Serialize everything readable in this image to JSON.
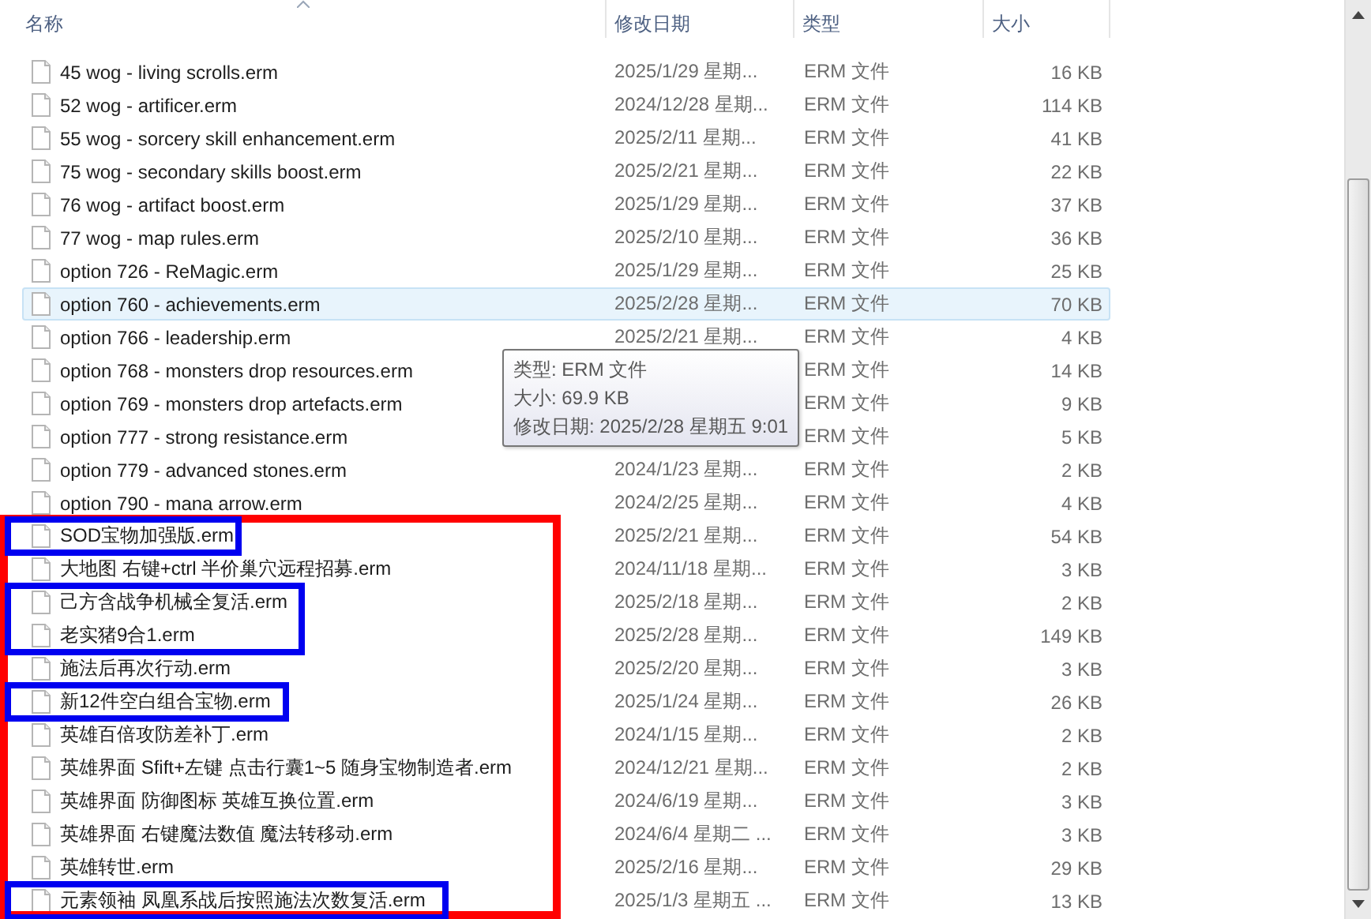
{
  "table": {
    "columns": [
      {
        "label": "名称",
        "sorted": true
      },
      {
        "label": "修改日期",
        "sorted": false
      },
      {
        "label": "类型",
        "sorted": false
      },
      {
        "label": "大小",
        "sorted": false
      }
    ],
    "rows": [
      {
        "name": "45 wog - living scrolls.erm",
        "date": "2025/1/29 星期...",
        "type": "ERM 文件",
        "size": "16 KB",
        "hovered": false
      },
      {
        "name": "52 wog - artificer.erm",
        "date": "2024/12/28 星期...",
        "type": "ERM 文件",
        "size": "114 KB",
        "hovered": false
      },
      {
        "name": "55 wog - sorcery skill enhancement.erm",
        "date": "2025/2/11 星期...",
        "type": "ERM 文件",
        "size": "41 KB",
        "hovered": false
      },
      {
        "name": "75 wog - secondary skills boost.erm",
        "date": "2025/2/21 星期...",
        "type": "ERM 文件",
        "size": "22 KB",
        "hovered": false
      },
      {
        "name": "76 wog - artifact boost.erm",
        "date": "2025/1/29 星期...",
        "type": "ERM 文件",
        "size": "37 KB",
        "hovered": false
      },
      {
        "name": "77 wog - map rules.erm",
        "date": "2025/2/10 星期...",
        "type": "ERM 文件",
        "size": "36 KB",
        "hovered": false
      },
      {
        "name": "option 726 - ReMagic.erm",
        "date": "2025/1/29 星期...",
        "type": "ERM 文件",
        "size": "25 KB",
        "hovered": false
      },
      {
        "name": "option 760 - achievements.erm",
        "date": "2025/2/28 星期...",
        "type": "ERM 文件",
        "size": "70 KB",
        "hovered": true
      },
      {
        "name": "option 766 - leadership.erm",
        "date": "2025/2/21 星期...",
        "type": "ERM 文件",
        "size": "4 KB",
        "hovered": false
      },
      {
        "name": "option 768 - monsters drop resources.erm",
        "type": "ERM 文件",
        "size": "14 KB",
        "hovered": false
      },
      {
        "name": "option 769 - monsters drop artefacts.erm",
        "type": "ERM 文件",
        "size": "9 KB",
        "hovered": false
      },
      {
        "name": "option 777 - strong resistance.erm",
        "type": "ERM 文件",
        "size": "5 KB",
        "hovered": false
      },
      {
        "name": "option 779 - advanced stones.erm",
        "date": "2024/1/23 星期...",
        "type": "ERM 文件",
        "size": "2 KB",
        "hovered": false
      },
      {
        "name": "option 790 - mana arrow.erm",
        "date": "2024/2/25 星期...",
        "type": "ERM 文件",
        "size": "4 KB",
        "hovered": false
      }
    ],
    "marked_group": {
      "rows": [
        {
          "name": "SOD宝物加强版.erm",
          "date": "2025/2/21 星期...",
          "type": "ERM 文件",
          "size": "54 KB",
          "hovered": false,
          "boxed": true
        },
        {
          "name": "大地图 右键+ctrl 半价巢穴远程招募.erm",
          "date": "2024/11/18 星期...",
          "type": "ERM 文件",
          "size": "3 KB",
          "hovered": false,
          "boxed": false
        },
        {
          "name": "己方含战争机械全复活.erm",
          "date": "2025/2/18 星期...",
          "type": "ERM 文件",
          "size": "2 KB",
          "hovered": false,
          "boxed": true
        },
        {
          "name": "老实猪9合1.erm",
          "date": "2025/2/28 星期...",
          "type": "ERM 文件",
          "size": "149 KB",
          "hovered": false,
          "boxed": true
        },
        {
          "name": "施法后再次行动.erm",
          "date": "2025/2/20 星期...",
          "type": "ERM 文件",
          "size": "3 KB",
          "hovered": false,
          "boxed": false
        },
        {
          "name": "新12件空白组合宝物.erm",
          "date": "2025/1/24 星期...",
          "type": "ERM 文件",
          "size": "26 KB",
          "hovered": false,
          "boxed": true
        },
        {
          "name": "英雄百倍攻防差补丁.erm",
          "date": "2024/1/15 星期...",
          "type": "ERM 文件",
          "size": "2 KB",
          "hovered": false,
          "boxed": false
        },
        {
          "name": "英雄界面 Sfift+左键 点击行囊1~5 随身宝物制造者.erm",
          "date": "2024/12/21 星期...",
          "type": "ERM 文件",
          "size": "2 KB",
          "hovered": false,
          "boxed": false
        },
        {
          "name": "英雄界面 防御图标 英雄互换位置.erm",
          "date": "2024/6/19 星期...",
          "type": "ERM 文件",
          "size": "3 KB",
          "hovered": false,
          "boxed": false
        },
        {
          "name": "英雄界面 右键魔法数值 魔法转移动.erm",
          "date": "2024/6/4 星期二 ...",
          "type": "ERM 文件",
          "size": "3 KB",
          "hovered": false,
          "boxed": false
        },
        {
          "name": "英雄转世.erm",
          "date": "2025/2/16 星期...",
          "type": "ERM 文件",
          "size": "29 KB",
          "hovered": false,
          "boxed": false
        },
        {
          "name": "元素领袖 凤凰系战后按照施法次数复活.erm",
          "date": "2025/1/3 星期五 ...",
          "type": "ERM 文件",
          "size": "13 KB",
          "hovered": false,
          "boxed": true
        }
      ]
    }
  },
  "tooltip": {
    "lines": [
      "类型: ERM 文件",
      "大小: 69.9 KB",
      "修改日期: 2025/2/28 星期五 9:01"
    ]
  }
}
